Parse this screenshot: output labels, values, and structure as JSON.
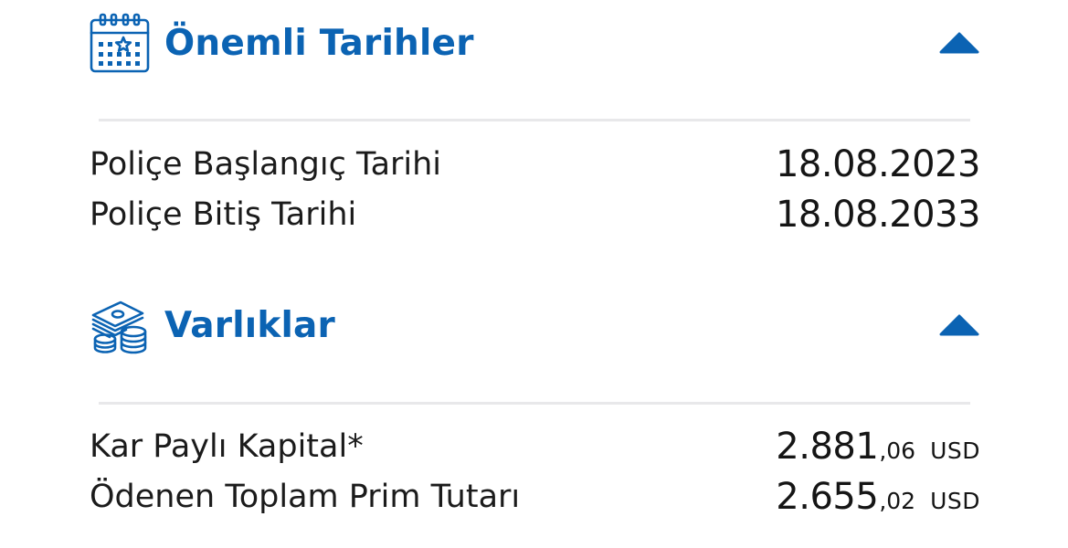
{
  "colors": {
    "accent": "#0b63b3",
    "text": "#1b1b1b",
    "divider": "#e8e8ea"
  },
  "sections": {
    "important_dates": {
      "icon": "calendar-star-icon",
      "title": "Önemli Tarihler",
      "expanded": true,
      "rows": [
        {
          "label": "Poliçe Başlangıç Tarihi",
          "value": "18.08.2023"
        },
        {
          "label": "Poliçe Bitiş Tarihi",
          "value": "18.08.2033"
        }
      ]
    },
    "assets": {
      "icon": "money-coins-icon",
      "title": "Varlıklar",
      "expanded": true,
      "rows": [
        {
          "label": "Kar Paylı Kapital*",
          "integer": "2.881",
          "decimal": ",06",
          "currency": "USD"
        },
        {
          "label": "Ödenen Toplam Prim Tutarı",
          "integer": "2.655",
          "decimal": ",02",
          "currency": "USD"
        }
      ]
    }
  }
}
